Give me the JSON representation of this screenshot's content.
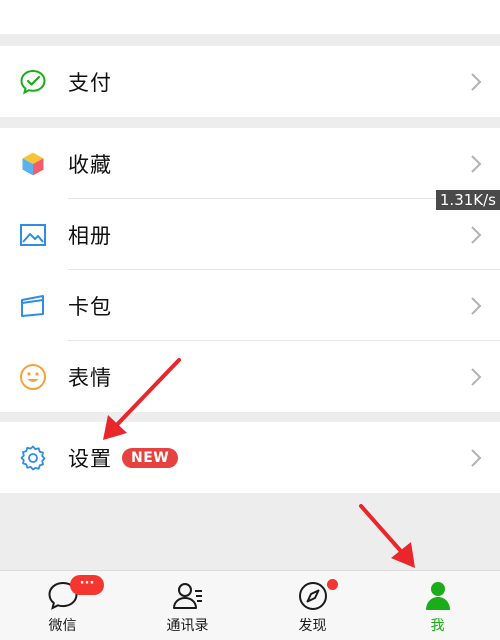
{
  "colors": {
    "background": "#ededed",
    "accent_green": "#1aad19",
    "badge_red": "#e64340",
    "annotation_arrow": "#e8262b"
  },
  "menu": {
    "pay": {
      "label": "支付",
      "icon": "wechat-pay-icon"
    },
    "favorites": {
      "label": "收藏",
      "icon": "cube-icon"
    },
    "album": {
      "label": "相册",
      "icon": "image-icon"
    },
    "card_wallet": {
      "label": "卡包",
      "icon": "card-icon"
    },
    "stickers": {
      "label": "表情",
      "icon": "smiley-icon"
    },
    "settings": {
      "label": "设置",
      "icon": "gear-icon",
      "badge": "NEW"
    }
  },
  "overlay": {
    "network_speed": "1.31K/s"
  },
  "tabbar": {
    "chats": {
      "label": "微信",
      "badge": "···",
      "icon": "chat-bubble-icon"
    },
    "contacts": {
      "label": "通讯录",
      "icon": "contacts-icon"
    },
    "discover": {
      "label": "发现",
      "icon": "compass-icon",
      "has_dot": true
    },
    "me": {
      "label": "我",
      "icon": "person-icon",
      "active": true
    }
  }
}
